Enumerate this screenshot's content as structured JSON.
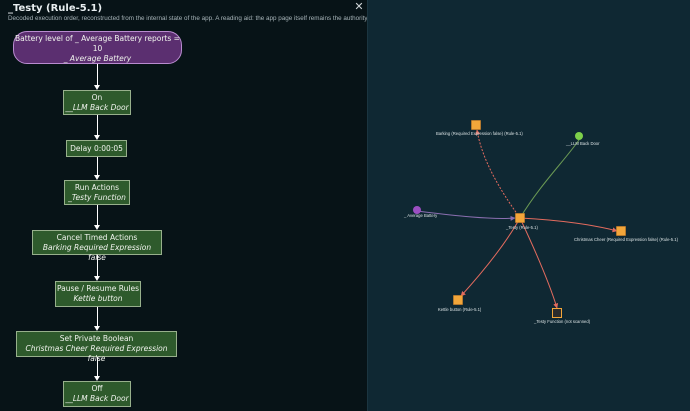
{
  "panel": {
    "title": "_Testy (Rule-5.1)",
    "close_glyph": "✕",
    "subtitle": "Decoded execution order, reconstructed from the internal state of the app. A reading aid: the app page itself remains the authority."
  },
  "flow": [
    {
      "title": "Battery level of _ Average Battery reports =",
      "title2": "10",
      "sub": "_ Average Battery",
      "kind": "trigger"
    },
    {
      "title": "On",
      "sub": "__LLM Back Door",
      "kind": "action"
    },
    {
      "title": "Delay 0:00:05",
      "sub": "",
      "kind": "action"
    },
    {
      "title": "Run Actions",
      "sub": "_Testy Function",
      "kind": "action"
    },
    {
      "title": "Cancel Timed Actions",
      "sub": "Barking Required Expression false",
      "kind": "action"
    },
    {
      "title": "Pause / Resume Rules",
      "sub": "Kettle button",
      "kind": "action"
    },
    {
      "title": "Set Private Boolean",
      "sub": "Christmas Cheer Required Expression false",
      "kind": "action"
    },
    {
      "title": "Off",
      "sub": "__LLM Back Door",
      "kind": "action"
    }
  ],
  "graph": {
    "nodes": [
      {
        "id": "center",
        "label": "_Testy (Rule-5.1)",
        "shape": "square",
        "color": "#f2a63a"
      },
      {
        "id": "barking",
        "label": "Barking (Required Expression false) (Rule-5.1)",
        "shape": "square",
        "color": "#f2a63a"
      },
      {
        "id": "llm",
        "label": "__LLM Back Door",
        "shape": "circle",
        "color": "#7dd04a"
      },
      {
        "id": "battery",
        "label": "_ Average Battery",
        "shape": "circle",
        "color": "#9b4fc2"
      },
      {
        "id": "christmas",
        "label": "Christmas Cheer (Required Expression false) (Rule-5.1)",
        "shape": "square",
        "color": "#f2a63a"
      },
      {
        "id": "kettle",
        "label": "Kettle button (Rule-5.1)",
        "shape": "square",
        "color": "#f2a63a"
      },
      {
        "id": "function",
        "label": "_Testy Function (not scanned)",
        "shape": "square-outline",
        "color": "#2b2b2b"
      }
    ],
    "edges": [
      {
        "from": "center",
        "to": "barking",
        "color": "#e36b5e",
        "dashed": true
      },
      {
        "from": "center",
        "to": "llm",
        "color": "#6b9a54",
        "dashed": false
      },
      {
        "from": "battery",
        "to": "center",
        "color": "#8a6fb0",
        "dashed": false
      },
      {
        "from": "center",
        "to": "christmas",
        "color": "#e36b5e",
        "dashed": false
      },
      {
        "from": "center",
        "to": "kettle",
        "color": "#e36b5e",
        "dashed": false
      },
      {
        "from": "center",
        "to": "function",
        "color": "#e36b5e",
        "dashed": false
      }
    ]
  },
  "colors": {
    "canvas_bg": "#0f2833",
    "panel_bg": "#071317",
    "action_node": "#2e5a2c",
    "trigger_node": "#5b2f70"
  }
}
